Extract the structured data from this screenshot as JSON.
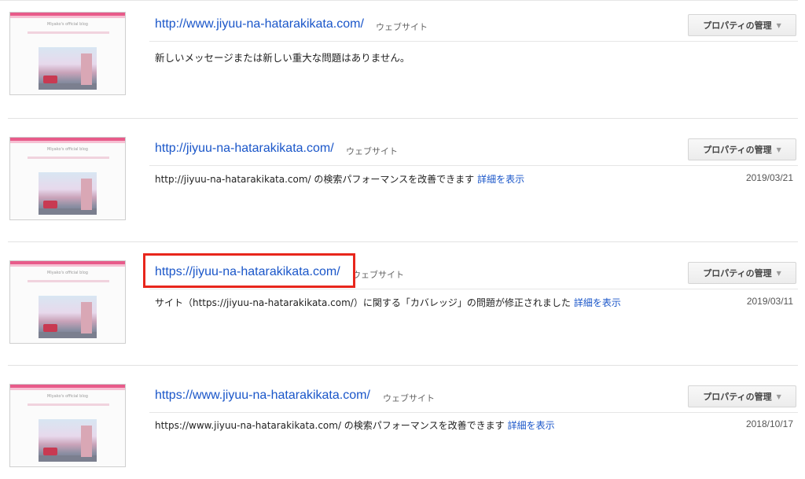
{
  "properties": [
    {
      "url": "http://www.jiyuu-na-hatarakikata.com/",
      "kind": "ウェブサイト",
      "manage_label": "プロパティの管理",
      "message": "新しいメッセージまたは新しい重大な問題はありません。",
      "detail_label": "",
      "date": "",
      "thumb_title": "Miyako's official blog"
    },
    {
      "url": "http://jiyuu-na-hatarakikata.com/",
      "kind": "ウェブサイト",
      "manage_label": "プロパティの管理",
      "message": "http://jiyuu-na-hatarakikata.com/ の検索パフォーマンスを改善できます",
      "detail_label": "詳細を表示",
      "date": "2019/03/21",
      "thumb_title": "Miyako's official blog"
    },
    {
      "url": "https://jiyuu-na-hatarakikata.com/",
      "kind": "ウェブサイト",
      "manage_label": "プロパティの管理",
      "message": "サイト（https://jiyuu-na-hatarakikata.com/）に関する「カバレッジ」の問題が修正されました",
      "detail_label": "詳細を表示",
      "date": "2019/03/11",
      "thumb_title": "Miyako's official blog",
      "highlighted": true
    },
    {
      "url": "https://www.jiyuu-na-hatarakikata.com/",
      "kind": "ウェブサイト",
      "manage_label": "プロパティの管理",
      "message": "https://www.jiyuu-na-hatarakikata.com/ の検索パフォーマンスを改善できます",
      "detail_label": "詳細を表示",
      "date": "2018/10/17",
      "thumb_title": "Miyako's official blog"
    }
  ],
  "colors": {
    "link": "#1a56c9",
    "highlight_border": "#e8261c",
    "thumb_accent": "#e85b8a"
  }
}
